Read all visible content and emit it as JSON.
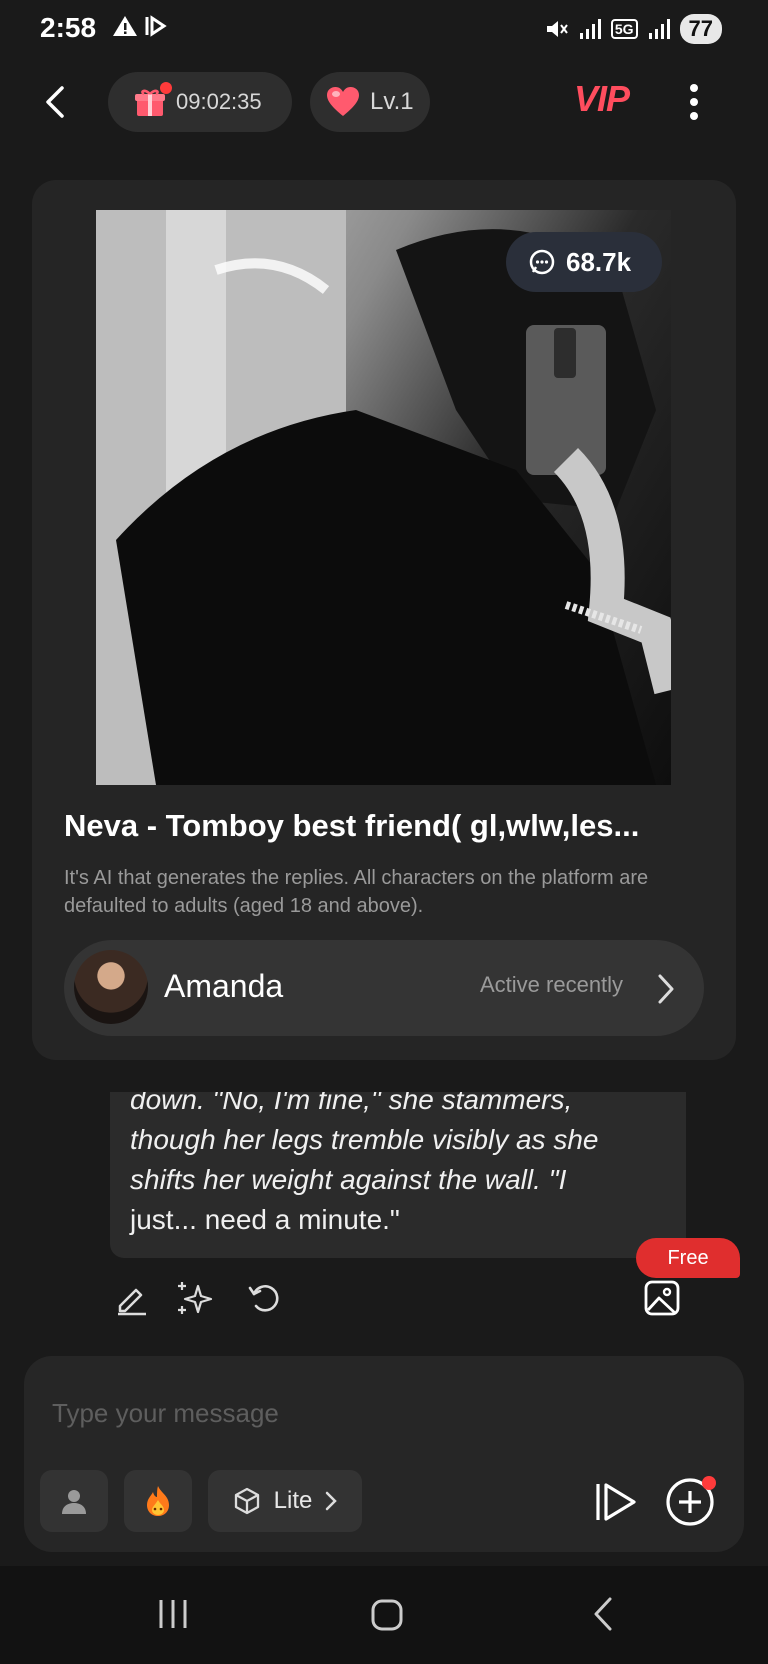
{
  "status_bar": {
    "time": "2:58",
    "network": "5G",
    "battery": "77"
  },
  "top_bar": {
    "timer": "09:02:35",
    "level": "Lv.1",
    "vip_label": "VIP"
  },
  "card": {
    "message_count": "68.7k",
    "title": "Neva - Tomboy best friend( gl,wlw,les...",
    "disclaimer": "It's AI that generates the replies. All characters on the platform are defaulted to adults (aged 18 and above).",
    "persona": {
      "name": "Amanda",
      "status": "Active recently"
    }
  },
  "message": {
    "line1": "down. \"No, I'm fine,\" she stammers,",
    "line2": "though her legs tremble visibly as she",
    "line3": "shifts her weight against the wall. \"I",
    "line4": "just... need a minute.\""
  },
  "free_badge": "Free",
  "input": {
    "placeholder": "Type your message",
    "model_label": "Lite"
  },
  "colors": {
    "accent": "#ff4d5e",
    "badge_red": "#e02e2e",
    "background": "#1a1a1a"
  }
}
